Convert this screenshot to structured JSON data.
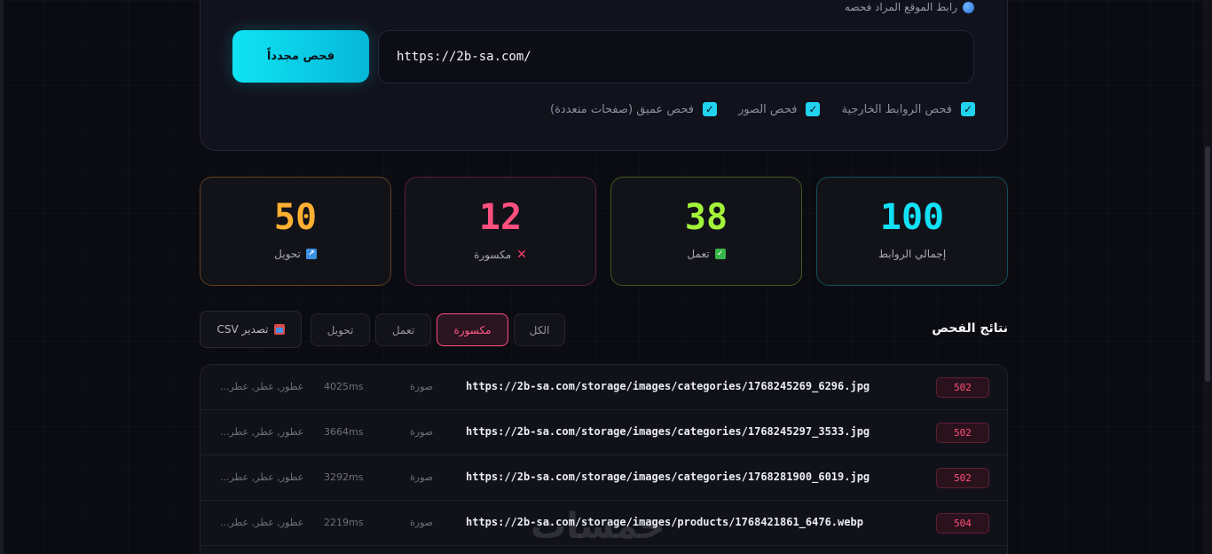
{
  "scan": {
    "url_label": "رابط الموقع المراد فحصه",
    "url_value": "https://2b-sa.com/",
    "scan_button": "فحص مجدداً",
    "options": [
      {
        "label": "فحص الروابط الخارجية",
        "checked": true
      },
      {
        "label": "فحص الصور",
        "checked": true
      },
      {
        "label": "فحص عميق (صفحات متعددة)",
        "checked": true
      }
    ]
  },
  "stats": {
    "total": {
      "value": "100",
      "label": "إجمالي الروابط",
      "color": "#12e0f5"
    },
    "working": {
      "value": "38",
      "label": "تعمل",
      "color": "#a3f339"
    },
    "broken": {
      "value": "12",
      "label": "مكسورة",
      "color": "#ff4f7e"
    },
    "redirect": {
      "value": "50",
      "label": "تحويل",
      "color": "#ffb033"
    }
  },
  "results": {
    "title": "نتائج الفحص",
    "tabs": {
      "all": "الكل",
      "broken": "مكسورة",
      "working": "تعمل",
      "redirect": "تحويل"
    },
    "export": "تصدير CSV",
    "rows": [
      {
        "status": "502",
        "url": "https://2b-sa.com/storage/images/categories/1768245269_6296.jpg",
        "type": "صورة",
        "time": "4025ms",
        "tags": "عطور, عطر, عطر..."
      },
      {
        "status": "502",
        "url": "https://2b-sa.com/storage/images/categories/1768245297_3533.jpg",
        "type": "صورة",
        "time": "3664ms",
        "tags": "عطور, عطر, عطر..."
      },
      {
        "status": "502",
        "url": "https://2b-sa.com/storage/images/categories/1768281900_6019.jpg",
        "type": "صورة",
        "time": "3292ms",
        "tags": "عطور, عطر, عطر..."
      },
      {
        "status": "504",
        "url": "https://2b-sa.com/storage/images/products/1768421861_6476.webp",
        "type": "صورة",
        "time": "2219ms",
        "tags": "عطور, عطر, عطر..."
      }
    ]
  },
  "watermark": "خمسات",
  "colors": {
    "accent": "#12e0f5",
    "broken": "#ff4f7e",
    "background": "#0b0b12"
  }
}
